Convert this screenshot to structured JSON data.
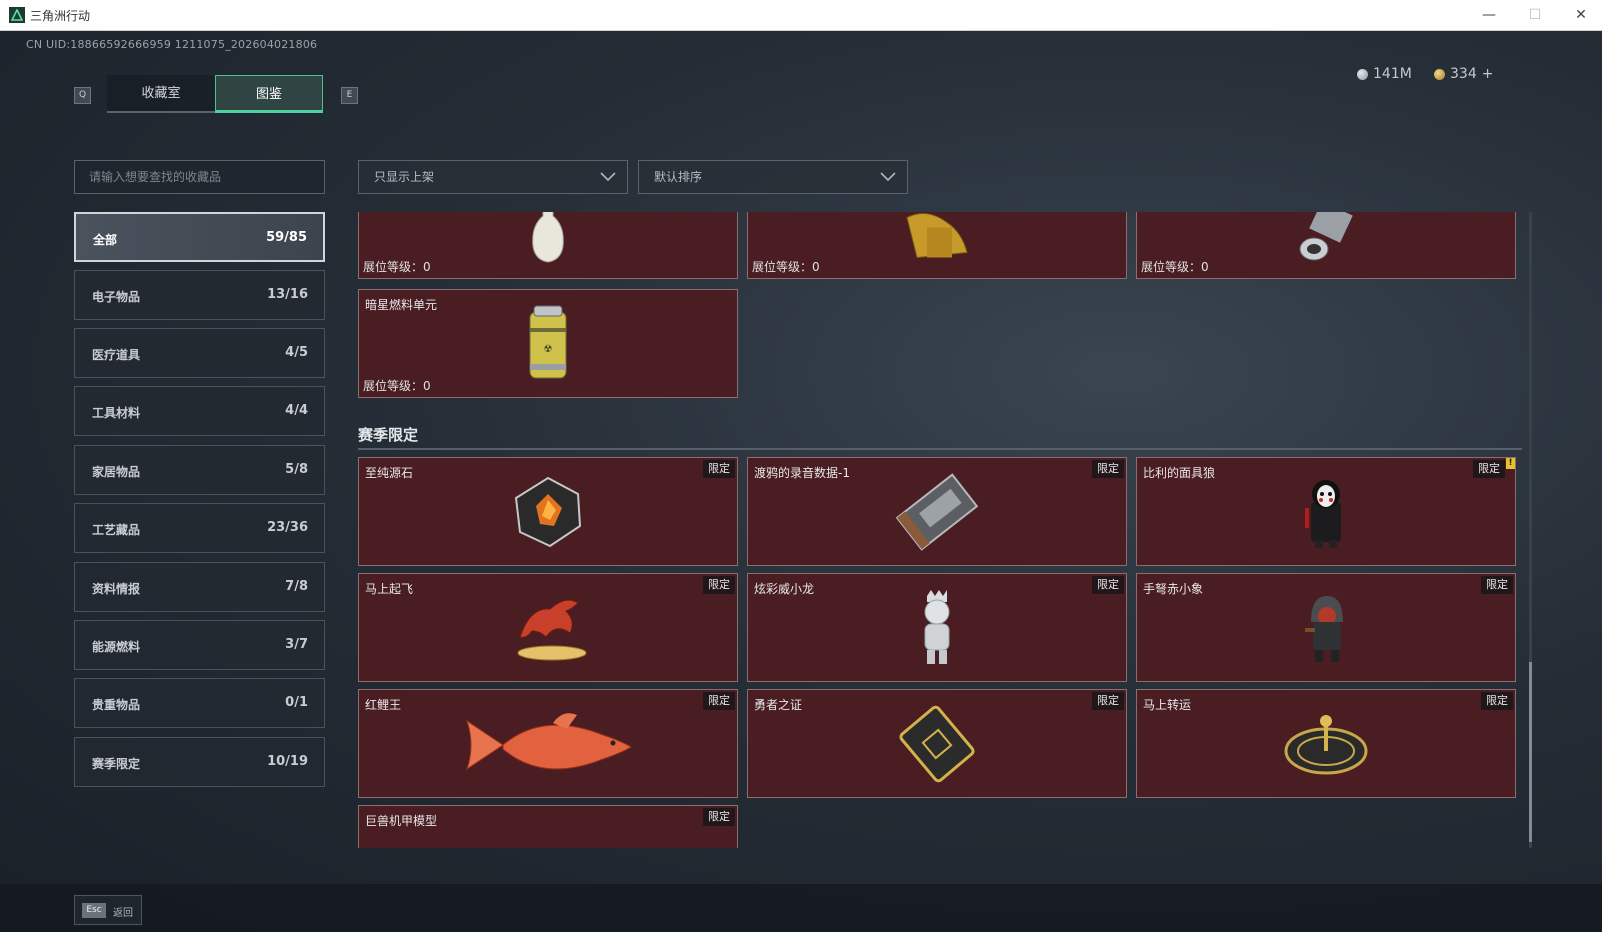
{
  "window": {
    "title": "三角洲行动",
    "min": "—",
    "max": "☐",
    "close": "✕"
  },
  "uid": "CN UID:18866592666959 1211075_202604021806",
  "tabs": {
    "q_key": "Q",
    "e_key": "E",
    "items": [
      {
        "label": "收藏室"
      },
      {
        "label": "图鉴"
      }
    ]
  },
  "currency": {
    "silver": "141M",
    "gold": "334",
    "plus": "+"
  },
  "search": {
    "placeholder": "请输入想要查找的收藏品"
  },
  "filters": {
    "filter": "只显示上架",
    "sort": "默认排序"
  },
  "categories": [
    {
      "label": "全部",
      "count": "59/85"
    },
    {
      "label": "电子物品",
      "count": "13/16"
    },
    {
      "label": "医疗道具",
      "count": "4/5"
    },
    {
      "label": "工具材料",
      "count": "4/4"
    },
    {
      "label": "家居物品",
      "count": "5/8"
    },
    {
      "label": "工艺藏品",
      "count": "23/36"
    },
    {
      "label": "资料情报",
      "count": "7/8"
    },
    {
      "label": "能源燃料",
      "count": "3/7"
    },
    {
      "label": "贵重物品",
      "count": "0/1"
    },
    {
      "label": "赛季限定",
      "count": "10/19"
    }
  ],
  "level_label": "展位等级：0",
  "limited_label": "限定",
  "top_items": [
    {
      "name": "",
      "icon": "vase-icon"
    },
    {
      "name": "",
      "icon": "golden-statue-icon"
    },
    {
      "name": "",
      "icon": "metal-cylinder-icon"
    },
    {
      "name": "暗星燃料单元",
      "icon": "fuel-canister-icon"
    }
  ],
  "section": {
    "title": "赛季限定"
  },
  "season_items": [
    {
      "name": "至纯源石",
      "icon": "source-stone-icon"
    },
    {
      "name": "渡鸦的录音数据-1",
      "icon": "cassette-icon"
    },
    {
      "name": "比利的面具狼",
      "icon": "mask-figure-icon"
    },
    {
      "name": "马上起飞",
      "icon": "horse-statue-icon"
    },
    {
      "name": "炫彩威小龙",
      "icon": "silver-figure-icon"
    },
    {
      "name": "手弩赤小象",
      "icon": "hooded-figure-icon"
    },
    {
      "name": "红鲤王",
      "icon": "koi-fish-icon"
    },
    {
      "name": "勇者之证",
      "icon": "badge-card-icon"
    },
    {
      "name": "马上转运",
      "icon": "fortune-wheel-icon"
    },
    {
      "name": "巨兽机甲模型",
      "icon": "mech-model-icon"
    }
  ],
  "footer": {
    "esc_key": "Esc",
    "back": "返回"
  },
  "colors": {
    "accent": "#4fd1a0",
    "card_bg": "#4a1d22",
    "card_border": "#8a6f70"
  }
}
